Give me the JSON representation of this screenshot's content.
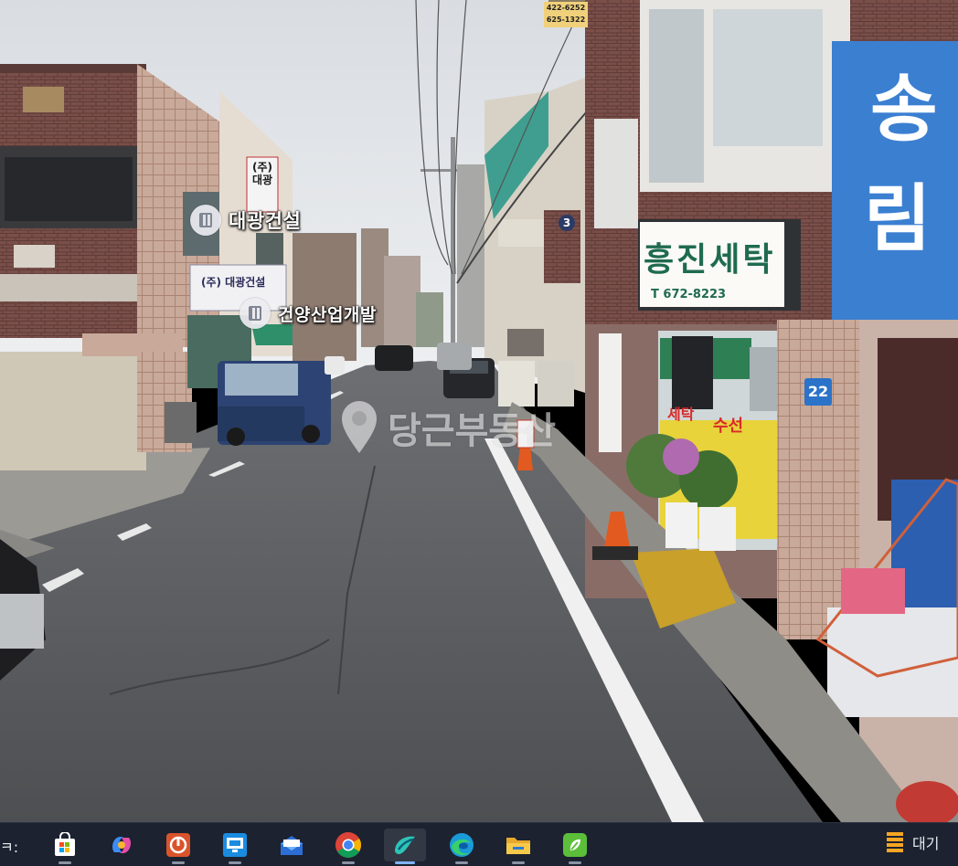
{
  "street_view": {
    "pois": [
      {
        "name": "대광건설"
      },
      {
        "name": "건양산업개발"
      }
    ],
    "signs": {
      "laundry_name": "흥진세탁",
      "laundry_phone": "T 672-8223",
      "window_text_1": "세탁",
      "window_text_2": "수선",
      "top_sign_phone_1": "422-6252",
      "top_sign_phone_2": "625-1322",
      "address_number": "22",
      "building_number": "3",
      "blue_sign_1": "송",
      "blue_sign_2": "림",
      "daegwang_sign": "(주) 대광건설",
      "vertical_sign": "(주)대광"
    },
    "watermark": "당근부동산"
  },
  "taskbar": {
    "left_text": "ㅋ:",
    "right_text": "대기",
    "icons": [
      {
        "id": "store",
        "icon": "microsoft-store-icon"
      },
      {
        "id": "copilot",
        "icon": "copilot-icon"
      },
      {
        "id": "office",
        "icon": "office-app-icon"
      },
      {
        "id": "remote",
        "icon": "remote-desktop-icon"
      },
      {
        "id": "outlook",
        "icon": "mail-app-icon"
      },
      {
        "id": "chrome",
        "icon": "chrome-icon"
      },
      {
        "id": "active-app",
        "icon": "active-app-icon"
      },
      {
        "id": "edge",
        "icon": "edge-icon"
      },
      {
        "id": "explorer",
        "icon": "file-explorer-icon"
      },
      {
        "id": "green-app",
        "icon": "green-app-icon"
      }
    ]
  },
  "colors": {
    "taskbar_bg": "#1c2230",
    "accent": "#7fb4ff"
  }
}
